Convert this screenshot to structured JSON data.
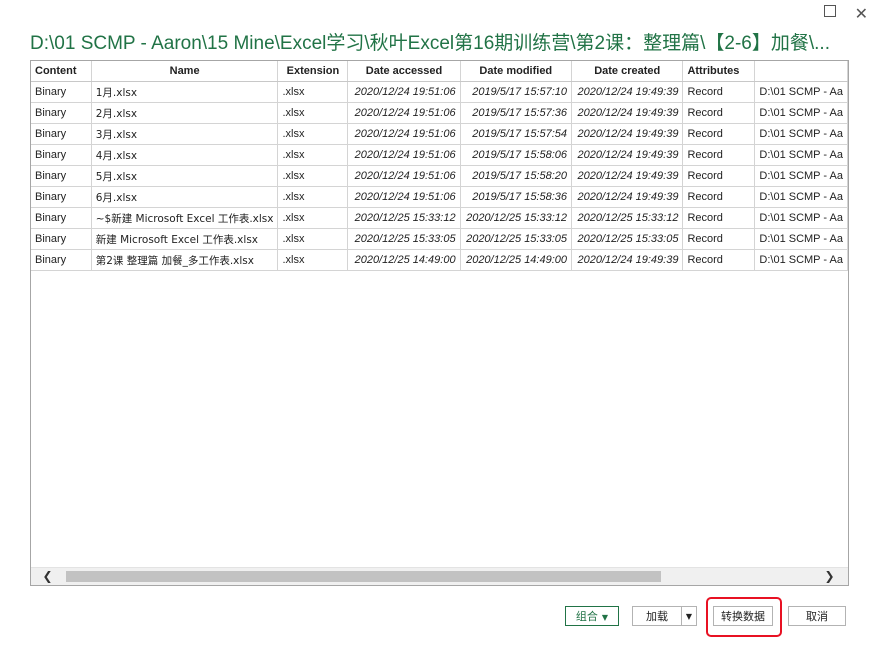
{
  "window": {
    "title": "D:\\01 SCMP - Aaron\\15 Mine\\Excel学习\\秋叶Excel第16期训练营\\第2课：整理篇\\【2-6】加餐\\...",
    "maximize_glyph": "",
    "close_glyph": "✕"
  },
  "table": {
    "columns": [
      "Content",
      "Name",
      "Extension",
      "Date accessed",
      "Date modified",
      "Date created",
      "Attributes",
      ""
    ],
    "rows": [
      [
        "Binary",
        "1月.xlsx",
        ".xlsx",
        "2020/12/24 19:51:06",
        "2019/5/17 15:57:10",
        "2020/12/24 19:49:39",
        "Record",
        "D:\\01 SCMP - Aa"
      ],
      [
        "Binary",
        "2月.xlsx",
        ".xlsx",
        "2020/12/24 19:51:06",
        "2019/5/17 15:57:36",
        "2020/12/24 19:49:39",
        "Record",
        "D:\\01 SCMP - Aa"
      ],
      [
        "Binary",
        "3月.xlsx",
        ".xlsx",
        "2020/12/24 19:51:06",
        "2019/5/17 15:57:54",
        "2020/12/24 19:49:39",
        "Record",
        "D:\\01 SCMP - Aa"
      ],
      [
        "Binary",
        "4月.xlsx",
        ".xlsx",
        "2020/12/24 19:51:06",
        "2019/5/17 15:58:06",
        "2020/12/24 19:49:39",
        "Record",
        "D:\\01 SCMP - Aa"
      ],
      [
        "Binary",
        "5月.xlsx",
        ".xlsx",
        "2020/12/24 19:51:06",
        "2019/5/17 15:58:20",
        "2020/12/24 19:49:39",
        "Record",
        "D:\\01 SCMP - Aa"
      ],
      [
        "Binary",
        "6月.xlsx",
        ".xlsx",
        "2020/12/24 19:51:06",
        "2019/5/17 15:58:36",
        "2020/12/24 19:49:39",
        "Record",
        "D:\\01 SCMP - Aa"
      ],
      [
        "Binary",
        "~$新建 Microsoft Excel 工作表.xlsx",
        ".xlsx",
        "2020/12/25 15:33:12",
        "2020/12/25 15:33:12",
        "2020/12/25 15:33:12",
        "Record",
        "D:\\01 SCMP - Aa"
      ],
      [
        "Binary",
        "新建 Microsoft Excel 工作表.xlsx",
        ".xlsx",
        "2020/12/25 15:33:05",
        "2020/12/25 15:33:05",
        "2020/12/25 15:33:05",
        "Record",
        "D:\\01 SCMP - Aa"
      ],
      [
        "Binary",
        "第2课 整理篇 加餐_多工作表.xlsx",
        ".xlsx",
        "2020/12/25 14:49:00",
        "2020/12/25 14:49:00",
        "2020/12/24 19:49:39",
        "Record",
        "D:\\01 SCMP - Aa"
      ]
    ]
  },
  "scrollbar": {
    "left_glyph": "❮",
    "right_glyph": "❯"
  },
  "buttons": {
    "combine": "组合",
    "load": "加载",
    "transform": "转换数据",
    "cancel": "取消",
    "dropdown_glyph": "▼"
  },
  "colors": {
    "accent": "#217346",
    "highlight": "#e81123"
  }
}
